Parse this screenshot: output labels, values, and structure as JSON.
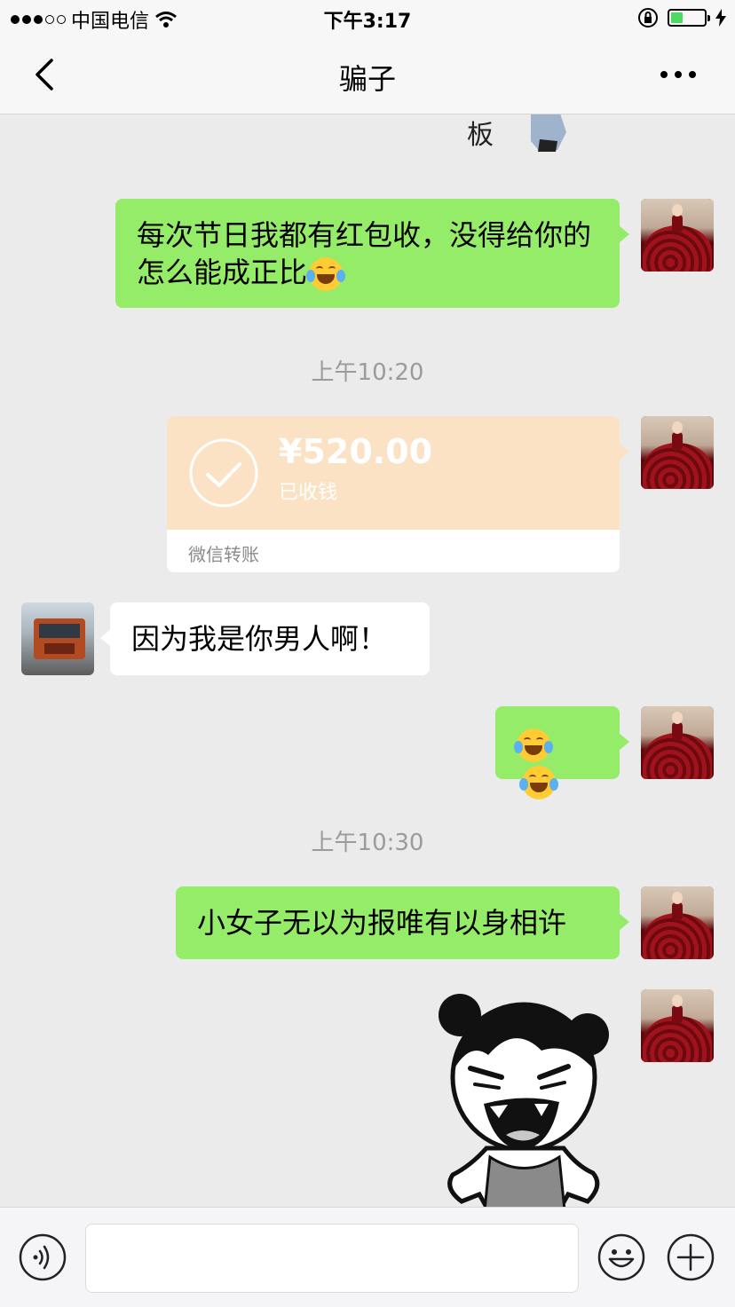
{
  "status_bar": {
    "carrier": "中国电信",
    "time": "下午3:17",
    "signal_bars": 3,
    "signal_total": 5,
    "battery_level": 0.35
  },
  "navbar": {
    "title": "骗子",
    "back_icon": "chevron-left-icon",
    "more_icon": "more-dots-icon"
  },
  "messages": {
    "m1": {
      "text": "每次节日我都有红包收，没得给你的怎么能成正比"
    },
    "ts1": "上午10:20",
    "transfer": {
      "amount": "¥520.00",
      "status": "已收钱",
      "footer": "微信转账"
    },
    "m2": {
      "text": "因为我是你男人啊！"
    },
    "ts2": "上午10:30",
    "m4": {
      "text": "小女子无以为报唯有以身相许"
    }
  },
  "sticker_top_char": "板",
  "colors": {
    "my_bubble": "#95ec69",
    "other_bubble": "#ffffff",
    "transfer_bg": "#fce2c4",
    "background": "#ebebeb"
  },
  "input_bar": {
    "voice_icon": "voice-icon",
    "emoji_icon": "emoji-icon",
    "plus_icon": "plus-icon"
  }
}
